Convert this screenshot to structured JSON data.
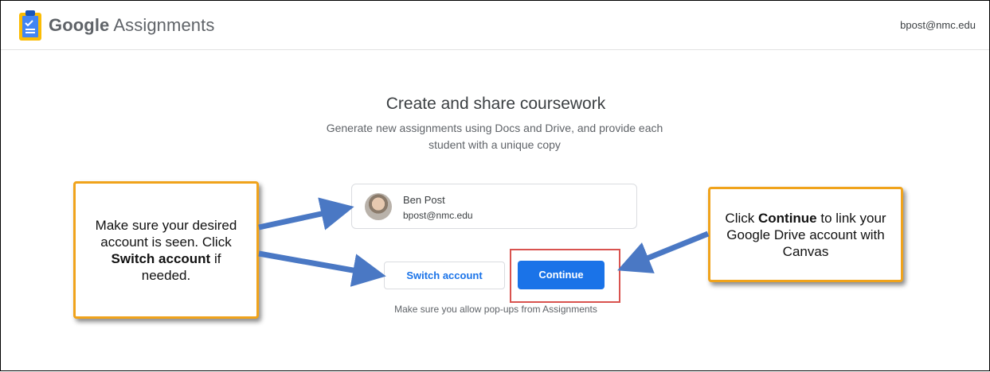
{
  "header": {
    "brand_google": "Google",
    "brand_product": "Assignments",
    "account_email": "bpost@nmc.edu",
    "logo_icon": "assignments-clipboard-icon"
  },
  "main": {
    "title": "Create and share coursework",
    "subtitle": "Generate new assignments using Docs and Drive, and provide each student with a unique copy",
    "account": {
      "name": "Ben Post",
      "email": "bpost@nmc.edu"
    },
    "switch_account_label": "Switch account",
    "continue_label": "Continue",
    "popup_note": "Make sure you allow pop-ups from Assignments"
  },
  "callouts": {
    "left": {
      "line1": "Make sure your desired account is seen. Click ",
      "bold": "Switch account",
      "line2": " if needed."
    },
    "right": {
      "line1": "Click ",
      "bold": "Continue",
      "line2": " to link your Google Drive account with Canvas"
    }
  },
  "colors": {
    "primary": "#1a73e8",
    "callout_border": "#f0a31b",
    "highlight": "#d9534f",
    "arrow": "#4a78c4"
  }
}
